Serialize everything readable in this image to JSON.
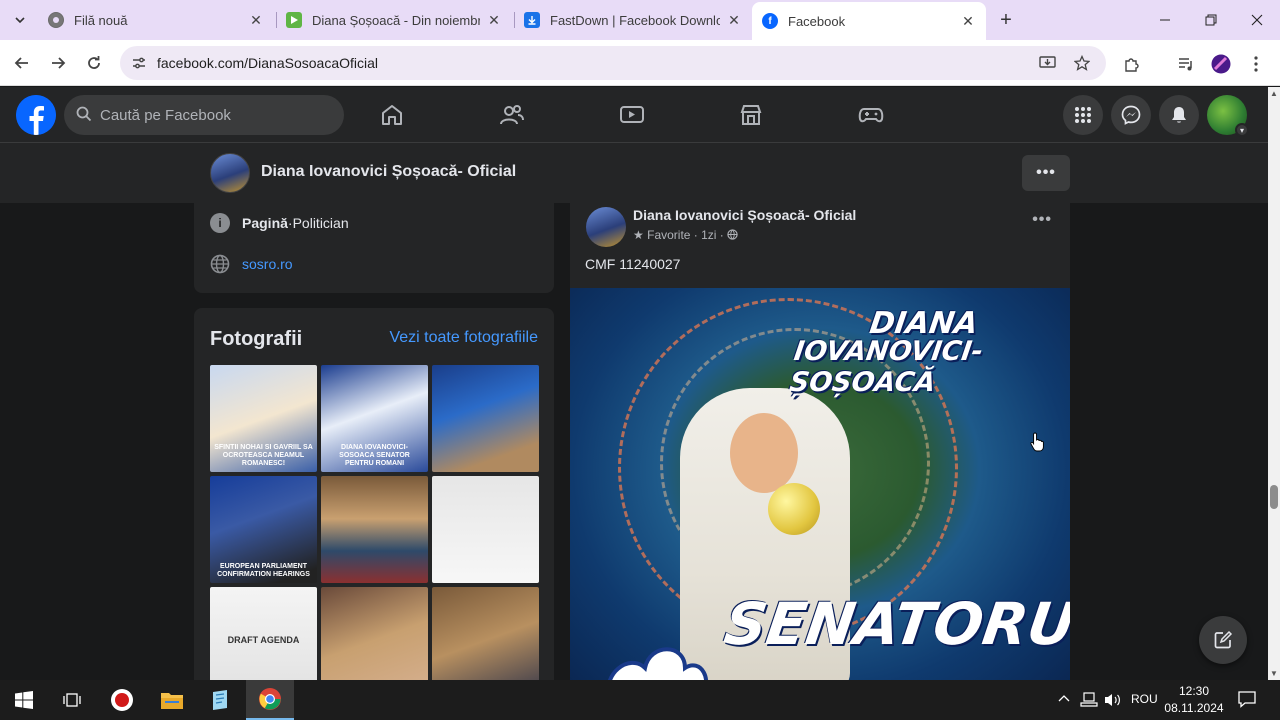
{
  "browser": {
    "tabs": [
      {
        "title": "Filă nouă",
        "favicon": "chrome-icon",
        "active": false
      },
      {
        "title": "Diana Șoșoacă - Din noiembrie",
        "favicon": "video-play-icon",
        "active": false
      },
      {
        "title": "FastDown | Facebook Downloa",
        "favicon": "download-icon",
        "active": false
      },
      {
        "title": "Facebook",
        "favicon": "facebook-icon",
        "active": true
      }
    ],
    "url": "facebook.com/DianaSosoacaOficial"
  },
  "fb": {
    "search_placeholder": "Caută pe Facebook",
    "page_name": "Diana Iovanovici Șoșoacă- Oficial",
    "more_label": "•••"
  },
  "intro": {
    "category_prefix": "Pagină",
    "category_sep": " · ",
    "category": "Politician",
    "website": "sosro.ro"
  },
  "photos": {
    "title": "Fotografii",
    "see_all": "Vezi toate fotografiile",
    "thumbs": [
      {
        "caption": "SFINTII NOHAI SI GAVRIIL SA OCROTEASCA NEAMUL ROMANESC!",
        "bg": "linear-gradient(160deg,#c8d8f0,#f3e6d0 50%,#3a5fa8)"
      },
      {
        "caption": "DIANA IOVANOVICI-SOSOACA SENATOR PENTRU ROMANI",
        "bg": "linear-gradient(160deg,#1b3d8f,#e8eef8 45%,#2a4a9a)"
      },
      {
        "caption": "",
        "bg": "linear-gradient(160deg,#1a3e8a,#2b6bc8 40%,#b08a60 80%)"
      },
      {
        "caption": "EUROPEAN PARLIAMENT CONFIRMATION HEARINGS",
        "bg": "linear-gradient(160deg,#163d9a,#3a5aa5 40%,#222 90%)"
      },
      {
        "caption": "",
        "bg": "linear-gradient(180deg,#7a5a3a,#c9a070 40%,#2e4a6a 70%,#8b3030)"
      },
      {
        "caption": "",
        "bg": "linear-gradient(180deg,#e6e6e6,#f7f7f7)"
      },
      {
        "caption": "DRAFT AGENDA",
        "bg": "linear-gradient(180deg,#f4f4f4,#e2e2e2)"
      },
      {
        "caption": "",
        "bg": "linear-gradient(160deg,#6a4a3a,#c8a070 50%,#d6b090)"
      },
      {
        "caption": "",
        "bg": "linear-gradient(160deg,#7a5a3a,#b89060 50%,#3a3a4a)"
      }
    ]
  },
  "post": {
    "author": "Diana Iovanovici Șoșoacă- Oficial",
    "meta_fav": "Favorite",
    "meta_time": " · 1zi · ",
    "text": "CMF 11240027",
    "image_text": {
      "line1": "DIANA",
      "line2": "IOVANOVICI-ȘOȘOACĂ",
      "line3": "SENATORUL"
    }
  },
  "taskbar": {
    "lang": "ROU",
    "time": "12:30",
    "date": "08.11.2024"
  },
  "colors": {
    "fb_blue": "#0866ff",
    "link": "#4599ff",
    "surface": "#242526",
    "background": "#18191a"
  }
}
